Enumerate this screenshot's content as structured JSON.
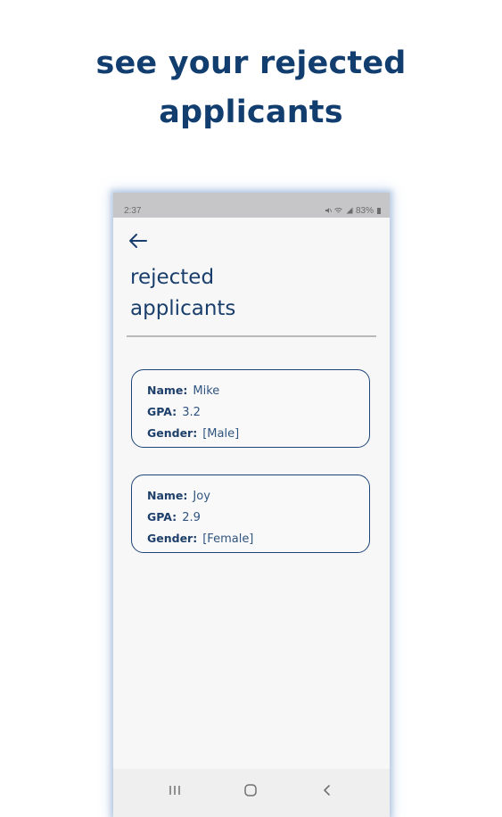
{
  "headline": {
    "line1": "see your rejected",
    "line2": "applicants"
  },
  "status_bar": {
    "time": "2:37",
    "battery": "83%"
  },
  "screen": {
    "title_line1": "rejected",
    "title_line2": "applicants"
  },
  "applicants": [
    {
      "name_label": "Name:",
      "name": "Mike",
      "gpa_label": "GPA:",
      "gpa": "3.2",
      "gender_label": "Gender:",
      "gender": "[Male]"
    },
    {
      "name_label": "Name:",
      "name": "Joy",
      "gpa_label": "GPA:",
      "gpa": "2.9",
      "gender_label": "Gender:",
      "gender": "[Female]"
    }
  ],
  "icons": {
    "back": "arrow-left-icon",
    "nav_recents": "recents-icon",
    "nav_home": "home-icon",
    "nav_back": "chevron-left-icon"
  },
  "colors": {
    "primary": "#123e6f",
    "card_border": "#1d4577",
    "screen_bg": "#f7f7f8",
    "status_bar_bg": "#c6c6c8"
  }
}
